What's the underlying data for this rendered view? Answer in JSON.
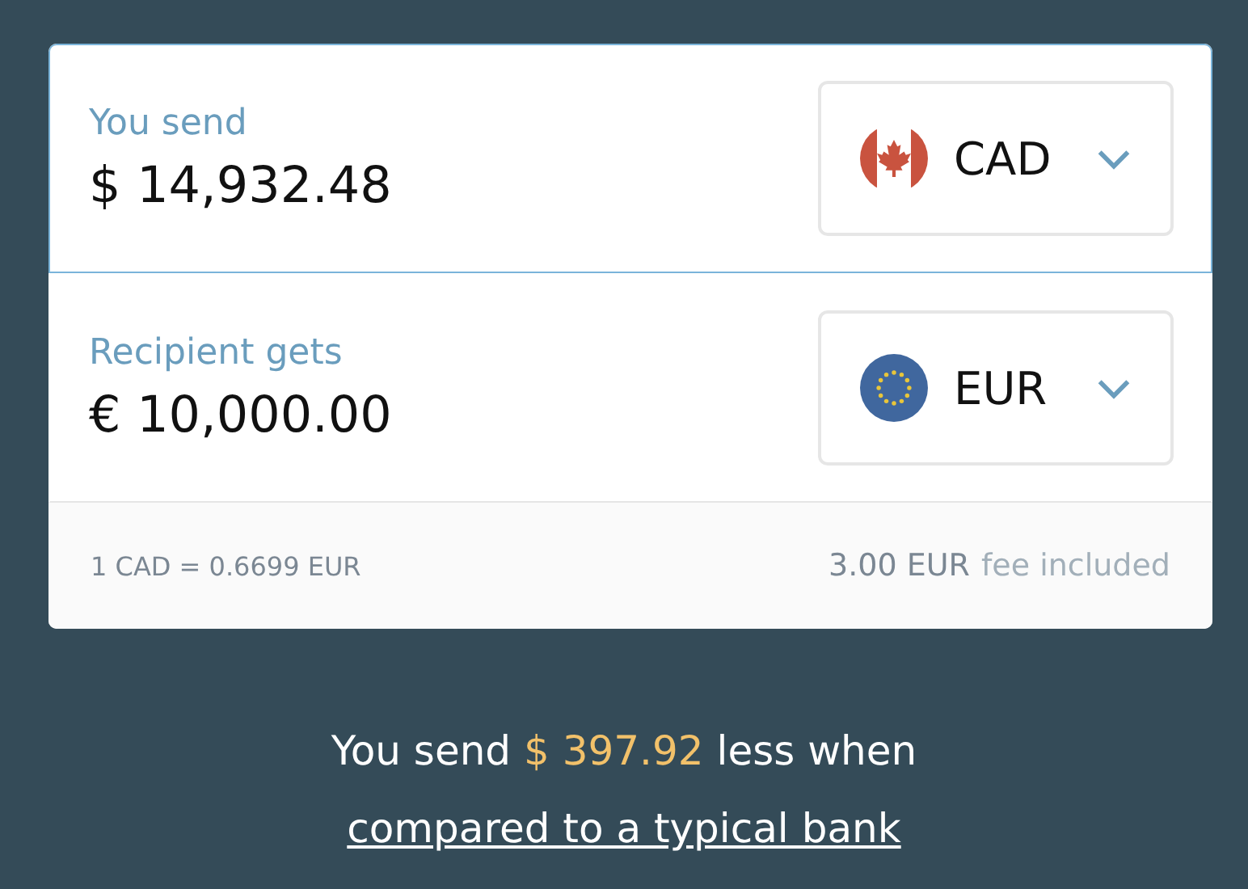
{
  "fields": [
    {
      "label": "You send",
      "value": "$ 14,932.48",
      "currency": "CAD",
      "kind": "canada",
      "focused": true
    },
    {
      "label": "Recipient gets",
      "value": "€ 10,000.00",
      "currency": "EUR",
      "kind": "eu",
      "focused": false
    }
  ],
  "rate": "1 CAD = 0.6699 EUR",
  "fee": {
    "amount": "3.00 EUR",
    "note": "fee included"
  },
  "savings": {
    "prefix": "You send",
    "amount": "$ 397.92",
    "middle": "less when",
    "link": "compared to a typical bank"
  }
}
